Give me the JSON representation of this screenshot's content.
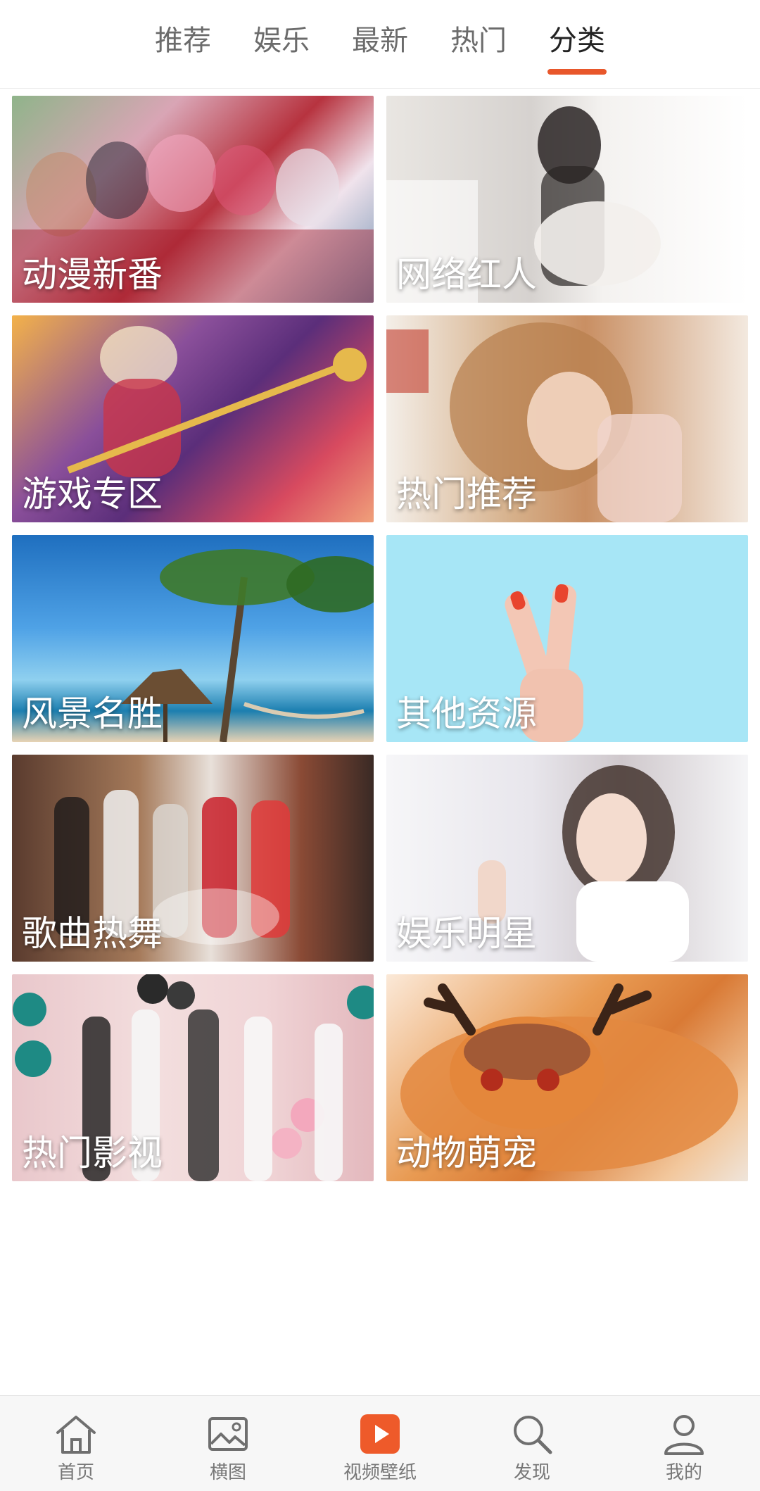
{
  "top_tabs": {
    "items": [
      {
        "label": "推荐"
      },
      {
        "label": "娱乐"
      },
      {
        "label": "最新"
      },
      {
        "label": "热门"
      },
      {
        "label": "分类"
      }
    ],
    "active_index": 4,
    "accent_color": "#e8572b"
  },
  "categories": [
    {
      "label": "动漫新番"
    },
    {
      "label": "网络红人"
    },
    {
      "label": "游戏专区"
    },
    {
      "label": "热门推荐"
    },
    {
      "label": "风景名胜"
    },
    {
      "label": "其他资源"
    },
    {
      "label": "歌曲热舞"
    },
    {
      "label": "娱乐明星"
    },
    {
      "label": "热门影视"
    },
    {
      "label": "动物萌宠"
    }
  ],
  "bottom_nav": {
    "items": [
      {
        "label": "首页",
        "icon": "home-icon"
      },
      {
        "label": "横图",
        "icon": "image-icon"
      },
      {
        "label": "视频壁纸",
        "icon": "play-icon"
      },
      {
        "label": "发现",
        "icon": "search-icon"
      },
      {
        "label": "我的",
        "icon": "user-icon"
      }
    ],
    "play_icon_color": "#ee5a2a"
  }
}
